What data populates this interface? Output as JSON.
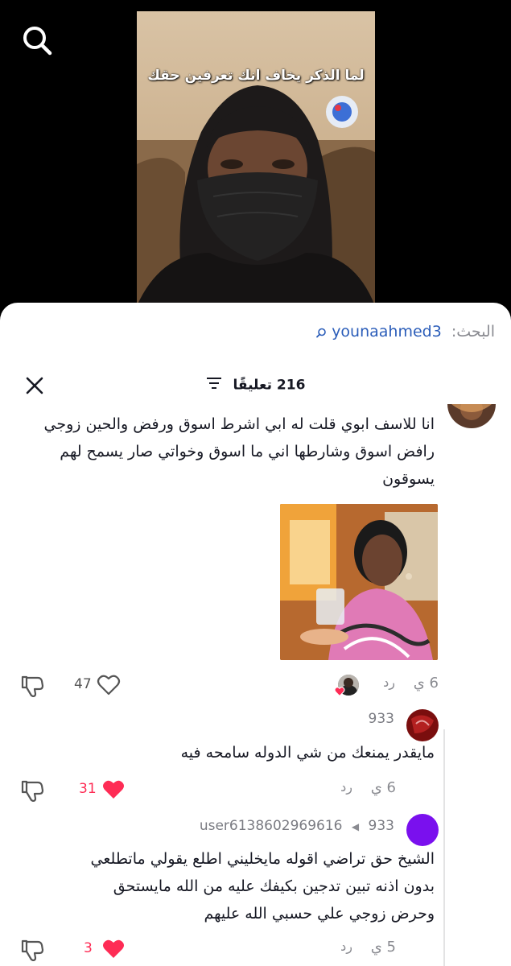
{
  "video": {
    "caption": "لما الذكر يخاف انك تعرفين حقك"
  },
  "search": {
    "label": "البحث:",
    "query": "younaahmed3"
  },
  "comments_header": {
    "count_label": "216 تعليقًا"
  },
  "comments": [
    {
      "text_lines": [
        "انا للاسف ابوي قلت له ابي اشرط اسوق ورفض والحين زوجي",
        "رافض اسوق وشارطها اني ما اسوق وخواتي صار يسمح لهم",
        "يسوقون"
      ],
      "has_image": true,
      "time": "6 ي",
      "reply_label": "رد",
      "likes": "47"
    }
  ],
  "replies": [
    {
      "username": "933",
      "text": "مايقدر يمنعك من شي الدوله سامحه فيه",
      "time": "6 ي",
      "reply_label": "رد",
      "likes": "31"
    },
    {
      "username": "user6138602969616",
      "reply_to": "933",
      "text_lines": [
        "الشيخ حق تراضي اقوله مايخليني اطلع يقولي ماتطلعي",
        "بدون اذنه تبين تدجين بكيفك عليه من الله مايستحق",
        "وحرض زوجي علي حسبي الله عليهم"
      ],
      "time": "5 ي",
      "reply_label": "رد",
      "likes": "3"
    }
  ],
  "colors": {
    "like_red": "#fe2c55",
    "link_blue": "#2b5db9",
    "muted_gray": "#8a8b91"
  }
}
